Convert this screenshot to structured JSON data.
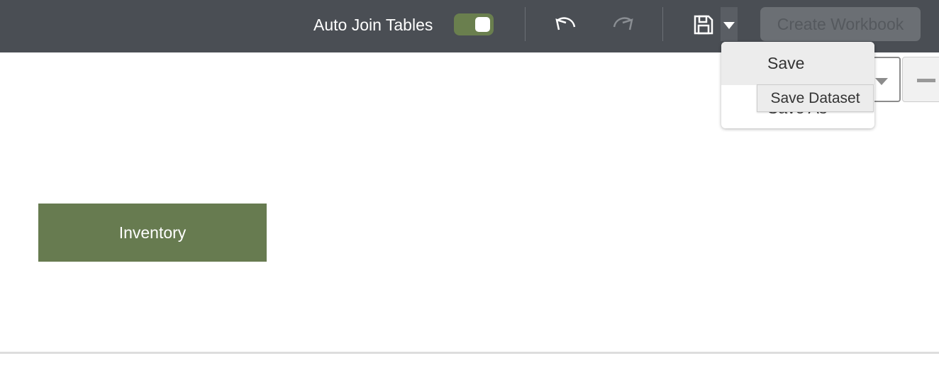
{
  "toolbar": {
    "auto_join_label": "Auto Join Tables",
    "auto_join_on": true,
    "create_workbook_label": "Create Workbook",
    "icons": [
      "undo-icon",
      "redo-icon",
      "save-icon",
      "caret-down-icon"
    ]
  },
  "save_menu": {
    "items": [
      {
        "label": "Save"
      },
      {
        "label": "Save As"
      }
    ],
    "tooltip": "Save Dataset"
  },
  "canvas": {
    "nodes": [
      {
        "label": "Inventory",
        "color": "#677b50"
      }
    ]
  }
}
